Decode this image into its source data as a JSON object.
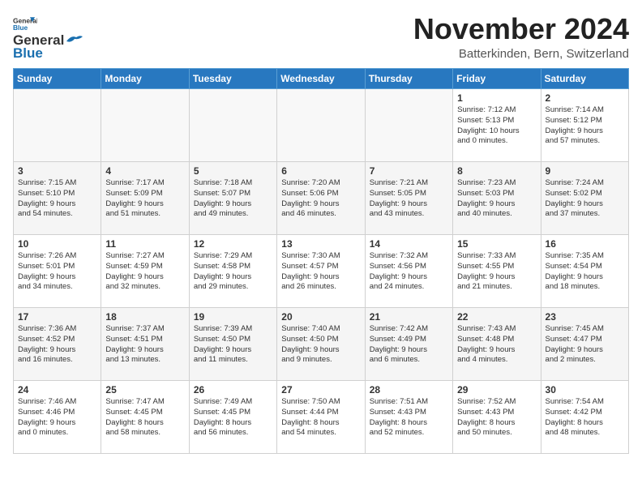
{
  "header": {
    "logo_line1": "General",
    "logo_line2": "Blue",
    "month_title": "November 2024",
    "location": "Batterkinden, Bern, Switzerland"
  },
  "weekdays": [
    "Sunday",
    "Monday",
    "Tuesday",
    "Wednesday",
    "Thursday",
    "Friday",
    "Saturday"
  ],
  "weeks": [
    [
      {
        "day": "",
        "info": ""
      },
      {
        "day": "",
        "info": ""
      },
      {
        "day": "",
        "info": ""
      },
      {
        "day": "",
        "info": ""
      },
      {
        "day": "",
        "info": ""
      },
      {
        "day": "1",
        "info": "Sunrise: 7:12 AM\nSunset: 5:13 PM\nDaylight: 10 hours\nand 0 minutes."
      },
      {
        "day": "2",
        "info": "Sunrise: 7:14 AM\nSunset: 5:12 PM\nDaylight: 9 hours\nand 57 minutes."
      }
    ],
    [
      {
        "day": "3",
        "info": "Sunrise: 7:15 AM\nSunset: 5:10 PM\nDaylight: 9 hours\nand 54 minutes."
      },
      {
        "day": "4",
        "info": "Sunrise: 7:17 AM\nSunset: 5:09 PM\nDaylight: 9 hours\nand 51 minutes."
      },
      {
        "day": "5",
        "info": "Sunrise: 7:18 AM\nSunset: 5:07 PM\nDaylight: 9 hours\nand 49 minutes."
      },
      {
        "day": "6",
        "info": "Sunrise: 7:20 AM\nSunset: 5:06 PM\nDaylight: 9 hours\nand 46 minutes."
      },
      {
        "day": "7",
        "info": "Sunrise: 7:21 AM\nSunset: 5:05 PM\nDaylight: 9 hours\nand 43 minutes."
      },
      {
        "day": "8",
        "info": "Sunrise: 7:23 AM\nSunset: 5:03 PM\nDaylight: 9 hours\nand 40 minutes."
      },
      {
        "day": "9",
        "info": "Sunrise: 7:24 AM\nSunset: 5:02 PM\nDaylight: 9 hours\nand 37 minutes."
      }
    ],
    [
      {
        "day": "10",
        "info": "Sunrise: 7:26 AM\nSunset: 5:01 PM\nDaylight: 9 hours\nand 34 minutes."
      },
      {
        "day": "11",
        "info": "Sunrise: 7:27 AM\nSunset: 4:59 PM\nDaylight: 9 hours\nand 32 minutes."
      },
      {
        "day": "12",
        "info": "Sunrise: 7:29 AM\nSunset: 4:58 PM\nDaylight: 9 hours\nand 29 minutes."
      },
      {
        "day": "13",
        "info": "Sunrise: 7:30 AM\nSunset: 4:57 PM\nDaylight: 9 hours\nand 26 minutes."
      },
      {
        "day": "14",
        "info": "Sunrise: 7:32 AM\nSunset: 4:56 PM\nDaylight: 9 hours\nand 24 minutes."
      },
      {
        "day": "15",
        "info": "Sunrise: 7:33 AM\nSunset: 4:55 PM\nDaylight: 9 hours\nand 21 minutes."
      },
      {
        "day": "16",
        "info": "Sunrise: 7:35 AM\nSunset: 4:54 PM\nDaylight: 9 hours\nand 18 minutes."
      }
    ],
    [
      {
        "day": "17",
        "info": "Sunrise: 7:36 AM\nSunset: 4:52 PM\nDaylight: 9 hours\nand 16 minutes."
      },
      {
        "day": "18",
        "info": "Sunrise: 7:37 AM\nSunset: 4:51 PM\nDaylight: 9 hours\nand 13 minutes."
      },
      {
        "day": "19",
        "info": "Sunrise: 7:39 AM\nSunset: 4:50 PM\nDaylight: 9 hours\nand 11 minutes."
      },
      {
        "day": "20",
        "info": "Sunrise: 7:40 AM\nSunset: 4:50 PM\nDaylight: 9 hours\nand 9 minutes."
      },
      {
        "day": "21",
        "info": "Sunrise: 7:42 AM\nSunset: 4:49 PM\nDaylight: 9 hours\nand 6 minutes."
      },
      {
        "day": "22",
        "info": "Sunrise: 7:43 AM\nSunset: 4:48 PM\nDaylight: 9 hours\nand 4 minutes."
      },
      {
        "day": "23",
        "info": "Sunrise: 7:45 AM\nSunset: 4:47 PM\nDaylight: 9 hours\nand 2 minutes."
      }
    ],
    [
      {
        "day": "24",
        "info": "Sunrise: 7:46 AM\nSunset: 4:46 PM\nDaylight: 9 hours\nand 0 minutes."
      },
      {
        "day": "25",
        "info": "Sunrise: 7:47 AM\nSunset: 4:45 PM\nDaylight: 8 hours\nand 58 minutes."
      },
      {
        "day": "26",
        "info": "Sunrise: 7:49 AM\nSunset: 4:45 PM\nDaylight: 8 hours\nand 56 minutes."
      },
      {
        "day": "27",
        "info": "Sunrise: 7:50 AM\nSunset: 4:44 PM\nDaylight: 8 hours\nand 54 minutes."
      },
      {
        "day": "28",
        "info": "Sunrise: 7:51 AM\nSunset: 4:43 PM\nDaylight: 8 hours\nand 52 minutes."
      },
      {
        "day": "29",
        "info": "Sunrise: 7:52 AM\nSunset: 4:43 PM\nDaylight: 8 hours\nand 50 minutes."
      },
      {
        "day": "30",
        "info": "Sunrise: 7:54 AM\nSunset: 4:42 PM\nDaylight: 8 hours\nand 48 minutes."
      }
    ]
  ]
}
